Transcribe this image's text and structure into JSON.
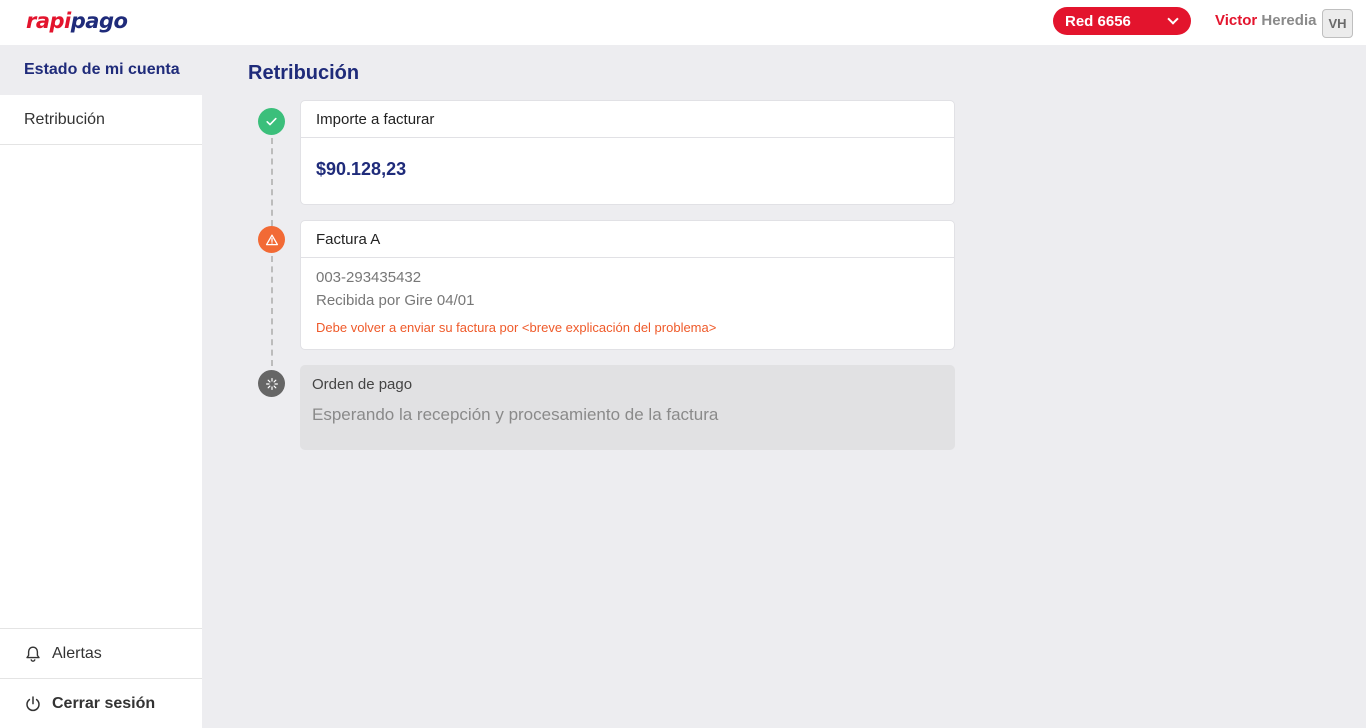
{
  "brand": {
    "logo_part1": "rapi",
    "logo_part2": "pago"
  },
  "header": {
    "network_select": "Red 6656",
    "user_first": "Victor",
    "user_last": "Heredia",
    "avatar_initials": "VH"
  },
  "sidebar": {
    "section_title": "Estado de mi cuenta",
    "items": [
      {
        "label": "Retribución"
      }
    ],
    "alerts_label": "Alertas",
    "logout_label": "Cerrar sesión"
  },
  "main": {
    "title": "Retribución",
    "steps": [
      {
        "status": "done",
        "title": "Importe a facturar",
        "amount": "$90.128,23"
      },
      {
        "status": "warning",
        "title": "Factura A",
        "number": "003-293435432",
        "received": "Recibida por Gire 04/01",
        "error": "Debe volver a enviar su factura por <breve explicación del problema>"
      },
      {
        "status": "pending",
        "title": "Orden de pago",
        "message": "Esperando la recepción y procesamiento de la factura"
      }
    ]
  },
  "colors": {
    "brand_red": "#e3142d",
    "brand_navy": "#1f2b7a",
    "success": "#3bbf7b",
    "warning": "#f26a35",
    "pending": "#666666"
  },
  "icons": [
    "check-icon",
    "warning-icon",
    "loading-icon",
    "bell-icon",
    "power-icon",
    "chevron-down-icon"
  ]
}
